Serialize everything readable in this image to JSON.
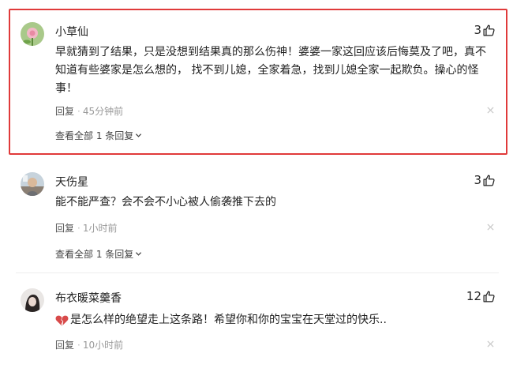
{
  "comments": [
    {
      "username": "小草仙",
      "likes": "3",
      "text_lines": [
        "早就猜到了结果，只是没想到结果真的那么伤神！婆婆一家这回应该后悔莫及了吧，真不",
        "知道有些婆家是怎么想的， 找不到儿媳，全家着急，找到儿媳全家一起欺负。操心的怪",
        "事！"
      ],
      "reply_label": "回复",
      "time": "45分钟前",
      "view_all": "查看全部 1 条回复",
      "highlighted": true
    },
    {
      "username": "天伤星",
      "likes": "3",
      "text_lines": [
        "能不能严查？会不会不小心被人偷袭推下去的"
      ],
      "reply_label": "回复",
      "time": "1小时前",
      "view_all": "查看全部 1 条回复"
    },
    {
      "username": "布衣暖菜羹香",
      "likes": "12",
      "text_lines": [
        "是怎么样的绝望走上这条路！希望你和你的宝宝在天堂过的快乐.."
      ],
      "emoji": "broken-heart-icon",
      "reply_label": "回复",
      "time": "10小时前"
    }
  ],
  "colors": {
    "highlight_border": "#e03a3a",
    "broken_heart": "#d84a4a"
  }
}
